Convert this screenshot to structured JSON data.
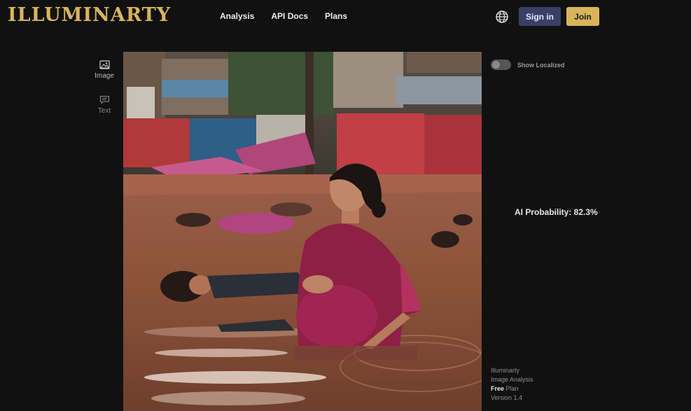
{
  "header": {
    "logo_text": "ILLUMINARTY",
    "nav": [
      "Analysis",
      "API Docs",
      "Plans"
    ],
    "globe_icon": "globe-icon",
    "signin_label": "Sign in",
    "join_label": "Join"
  },
  "sidebar": {
    "items": [
      {
        "label": "Image",
        "icon": "image-icon"
      },
      {
        "label": "Text",
        "icon": "chat-icon"
      }
    ]
  },
  "controls": {
    "show_localized_label": "Show Localized",
    "show_localized_on": false
  },
  "result": {
    "ai_probability_text": "AI Probability: 82.3%"
  },
  "footer": {
    "line1": "Illuminarty",
    "line2": "Image Analysis",
    "plan_bold": "Free",
    "plan_rest": " Plan",
    "version": "Version 1.4"
  },
  "colors": {
    "brand_gold": "#d9b45c",
    "signin_bg": "#3b3f66",
    "background": "#111111"
  }
}
